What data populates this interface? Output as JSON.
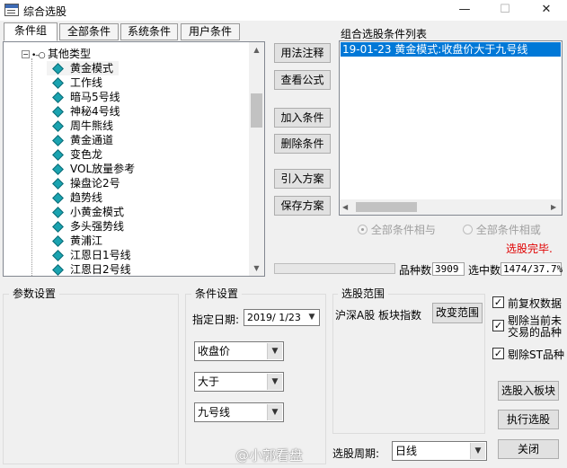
{
  "window": {
    "title": "综合选股",
    "minimize": "—",
    "maximize": "☐",
    "close": "✕"
  },
  "tabs": [
    "条件组",
    "全部条件",
    "系统条件",
    "用户条件"
  ],
  "tree": {
    "root_label": "其他类型",
    "root_toggle": "−",
    "items": [
      "黄金模式",
      "工作线",
      "暗马5号线",
      "神秘4号线",
      "周牛熊线",
      "黄金通道",
      "变色龙",
      "VOL放量参考",
      "操盘论2号",
      "趋势线",
      "小黄金模式",
      "多头强势线",
      "黄浦江",
      "江恩日1号线",
      "江恩日2号线"
    ]
  },
  "middle_buttons": {
    "usage": "用法注释",
    "formula": "查看公式",
    "add": "加入条件",
    "delete": "删除条件",
    "import": "引入方案",
    "save": "保存方案"
  },
  "right_panel": {
    "title": "组合选股条件列表",
    "items": [
      "19-01-23 黄金模式:收盘价大于九号线"
    ],
    "radio_and": "全部条件相与",
    "radio_or": "全部条件相或",
    "status": "选股完毕.",
    "status_color": "#e00000"
  },
  "stats": {
    "count_label": "品种数",
    "count_value": "3909",
    "selected_label": "选中数",
    "selected_value": "1474/37.7%"
  },
  "param": {
    "title": "参数设置"
  },
  "condition": {
    "title": "条件设置",
    "date_label": "指定日期:",
    "date_value": "2019/ 1/23",
    "field": "收盘价",
    "operator": "大于",
    "target": "九号线"
  },
  "range": {
    "title": "选股范围",
    "text": "沪深A股 板块指数",
    "button": "改变范围"
  },
  "options": [
    {
      "label": "前复权数据",
      "checked": true
    },
    {
      "label": "剔除当前未交易的品种",
      "checked": true
    },
    {
      "label": "剔除ST品种",
      "checked": true
    }
  ],
  "actions": {
    "to_block": "选股入板块",
    "execute": "执行选股",
    "close": "关闭"
  },
  "period": {
    "label": "选股周期:",
    "value": "日线"
  },
  "watermark": "@小郭看盘"
}
